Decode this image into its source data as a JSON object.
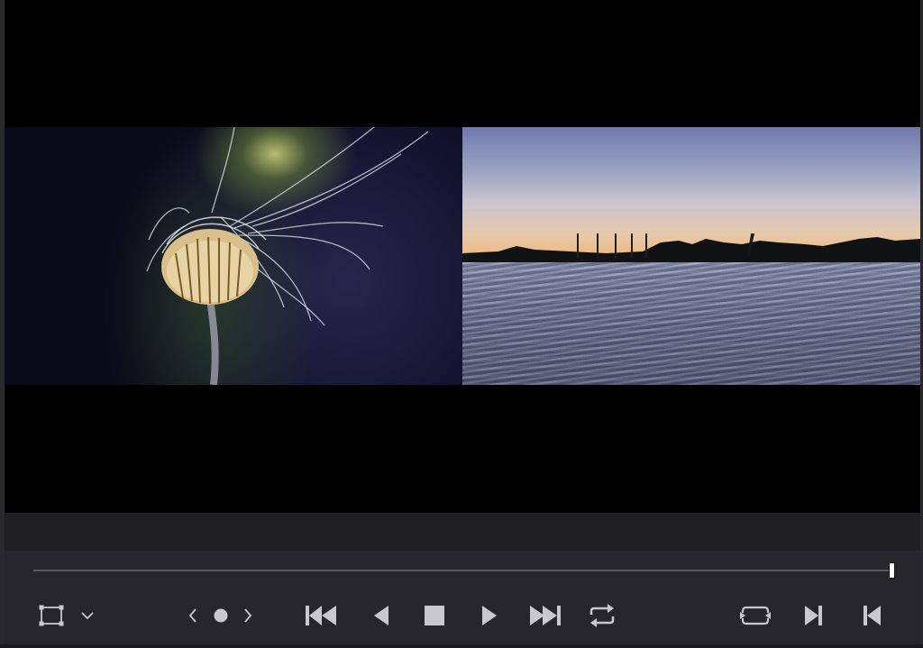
{
  "viewer": {
    "clips": [
      {
        "name": "jellyfish",
        "label": ""
      },
      {
        "name": "sunset-water",
        "label": ""
      }
    ]
  },
  "timeline": {
    "playhead_fraction": 1.0
  },
  "controls": {
    "view_mode_icon": "safe-area-icon",
    "view_dropdown_icon": "chevron-down-icon",
    "prev_marker_icon": "chevron-left-icon",
    "add_marker_icon": "marker-dot-icon",
    "next_marker_icon": "chevron-right-icon",
    "goto_start_icon": "skip-to-start-icon",
    "play_reverse_icon": "play-reverse-icon",
    "stop_icon": "stop-icon",
    "play_icon": "play-icon",
    "goto_end_icon": "skip-to-end-icon",
    "loop_icon": "loop-icon",
    "loop_range_icon": "loop-range-icon",
    "next_frame_icon": "step-forward-icon",
    "prev_frame_icon": "step-back-icon"
  },
  "colors": {
    "icon": "#c9c9cd",
    "background": "#27272b",
    "playhead": "#ffffff"
  }
}
